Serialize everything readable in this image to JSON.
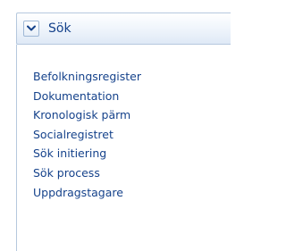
{
  "panel": {
    "title": "Sök",
    "toggle_icon": "chevron-down-icon"
  },
  "menu": {
    "items": [
      {
        "label": "Befolkningsregister"
      },
      {
        "label": "Dokumentation"
      },
      {
        "label": "Kronologisk pärm"
      },
      {
        "label": "Socialregistret"
      },
      {
        "label": "Sök initiering"
      },
      {
        "label": "Sök process"
      },
      {
        "label": "Uppdragstagare"
      }
    ]
  },
  "colors": {
    "accent": "#15428b",
    "border": "#b5c8de",
    "header_gradient_top": "#ffffff",
    "header_gradient_bottom": "#dfe9f6"
  }
}
